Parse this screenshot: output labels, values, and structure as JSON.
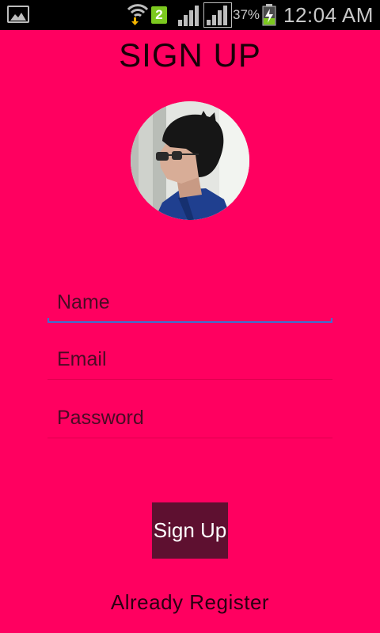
{
  "status_bar": {
    "sim_slot": "2",
    "battery_percent": "37%",
    "battery_level": 0.37,
    "time": "12:04 AM",
    "icons": [
      "gallery-icon",
      "wifi-download-icon",
      "sim-2-icon",
      "signal-icon",
      "signal-icon",
      "battery-charging-icon"
    ]
  },
  "page": {
    "title": "SIGN UP"
  },
  "form": {
    "name_placeholder": "Name",
    "email_placeholder": "Email",
    "password_placeholder": "Password",
    "focused_field": "name"
  },
  "actions": {
    "signup_label": "Sign Up",
    "already_register_label": "Already Register"
  },
  "colors": {
    "background": "#ff0060",
    "button": "#5e1030",
    "focus_underline": "#3f6fd0"
  }
}
